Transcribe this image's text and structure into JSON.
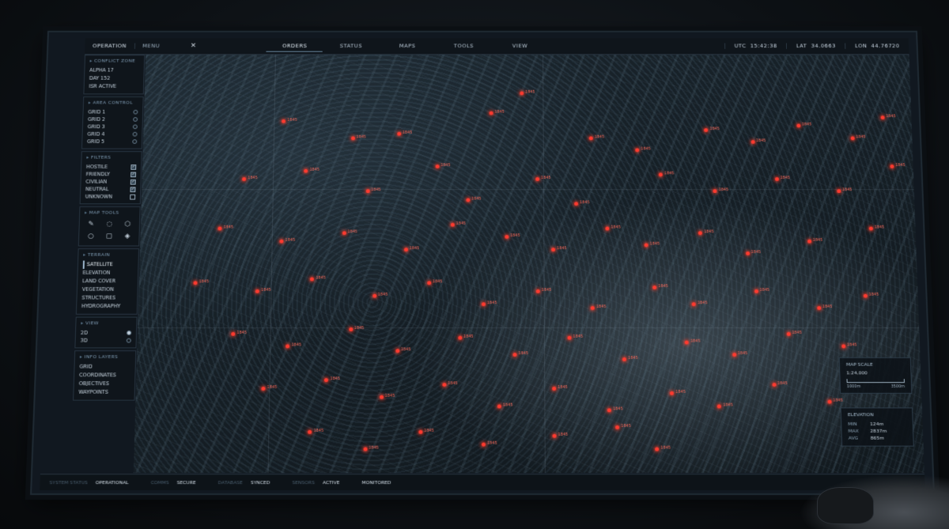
{
  "topbar": {
    "brand": "OPERATION",
    "menu": "MENU",
    "close_icon": "close-icon",
    "tabs": [
      "ORDERS",
      "STATUS",
      "MAPS",
      "TOOLS",
      "VIEW"
    ],
    "utc_label": "UTC",
    "utc_value": "15:42:38",
    "lat_label": "LAT",
    "lat_value": "34.0663",
    "lon_label": "LON",
    "lon_value": "44.76720"
  },
  "sidebar": {
    "conflict_zone": {
      "title": "CONFLICT ZONE",
      "lines": [
        "ALPHA 17",
        "DAY 152",
        "ISR ACTIVE"
      ]
    },
    "area_control": {
      "title": "AREA CONTROL",
      "items": [
        "GRID 1",
        "GRID 2",
        "GRID 3",
        "GRID 4",
        "GRID 5"
      ]
    },
    "filters": {
      "title": "FILTERS",
      "items": [
        {
          "label": "HOSTILE",
          "checked": true
        },
        {
          "label": "FRIENDLY",
          "checked": true
        },
        {
          "label": "CIVILIAN",
          "checked": true
        },
        {
          "label": "NEUTRAL",
          "checked": true
        },
        {
          "label": "UNKNOWN",
          "checked": false
        }
      ]
    },
    "map_tools": {
      "title": "MAP TOOLS",
      "tools": [
        "pencil-icon",
        "lasso-icon",
        "polygon-icon",
        "circle-icon",
        "rounded-shape-icon",
        "eraser-icon"
      ]
    },
    "terrain": {
      "title": "TERRAIN",
      "items": [
        "SATELLITE",
        "ELEVATION",
        "LAND COVER",
        "VEGETATION",
        "STRUCTURES",
        "HYDROGRAPHY"
      ],
      "active": "SATELLITE"
    },
    "view": {
      "title": "VIEW",
      "items": [
        "2D",
        "3D"
      ],
      "active": "2D"
    },
    "info_layers": {
      "title": "INFO LAYERS",
      "items": [
        "GRID",
        "COORDINATES",
        "OBJECTIVES",
        "WAYPOINTS"
      ]
    }
  },
  "map": {
    "marker_label": "1845",
    "markers": [
      [
        0.18,
        0.16
      ],
      [
        0.27,
        0.2
      ],
      [
        0.33,
        0.19
      ],
      [
        0.45,
        0.14
      ],
      [
        0.49,
        0.09
      ],
      [
        0.58,
        0.2
      ],
      [
        0.64,
        0.23
      ],
      [
        0.73,
        0.18
      ],
      [
        0.79,
        0.21
      ],
      [
        0.85,
        0.17
      ],
      [
        0.92,
        0.2
      ],
      [
        0.96,
        0.15
      ],
      [
        0.13,
        0.3
      ],
      [
        0.21,
        0.28
      ],
      [
        0.29,
        0.33
      ],
      [
        0.38,
        0.27
      ],
      [
        0.42,
        0.35
      ],
      [
        0.51,
        0.3
      ],
      [
        0.56,
        0.36
      ],
      [
        0.67,
        0.29
      ],
      [
        0.74,
        0.33
      ],
      [
        0.82,
        0.3
      ],
      [
        0.9,
        0.33
      ],
      [
        0.97,
        0.27
      ],
      [
        0.1,
        0.42
      ],
      [
        0.18,
        0.45
      ],
      [
        0.26,
        0.43
      ],
      [
        0.34,
        0.47
      ],
      [
        0.4,
        0.41
      ],
      [
        0.47,
        0.44
      ],
      [
        0.53,
        0.47
      ],
      [
        0.6,
        0.42
      ],
      [
        0.65,
        0.46
      ],
      [
        0.72,
        0.43
      ],
      [
        0.78,
        0.48
      ],
      [
        0.86,
        0.45
      ],
      [
        0.94,
        0.42
      ],
      [
        0.07,
        0.55
      ],
      [
        0.15,
        0.57
      ],
      [
        0.22,
        0.54
      ],
      [
        0.3,
        0.58
      ],
      [
        0.37,
        0.55
      ],
      [
        0.44,
        0.6
      ],
      [
        0.51,
        0.57
      ],
      [
        0.58,
        0.61
      ],
      [
        0.66,
        0.56
      ],
      [
        0.71,
        0.6
      ],
      [
        0.79,
        0.57
      ],
      [
        0.87,
        0.61
      ],
      [
        0.93,
        0.58
      ],
      [
        0.12,
        0.67
      ],
      [
        0.19,
        0.7
      ],
      [
        0.27,
        0.66
      ],
      [
        0.33,
        0.71
      ],
      [
        0.41,
        0.68
      ],
      [
        0.48,
        0.72
      ],
      [
        0.55,
        0.68
      ],
      [
        0.62,
        0.73
      ],
      [
        0.7,
        0.69
      ],
      [
        0.76,
        0.72
      ],
      [
        0.83,
        0.67
      ],
      [
        0.9,
        0.7
      ],
      [
        0.16,
        0.8
      ],
      [
        0.24,
        0.78
      ],
      [
        0.31,
        0.82
      ],
      [
        0.39,
        0.79
      ],
      [
        0.46,
        0.84
      ],
      [
        0.53,
        0.8
      ],
      [
        0.6,
        0.85
      ],
      [
        0.68,
        0.81
      ],
      [
        0.74,
        0.84
      ],
      [
        0.81,
        0.79
      ],
      [
        0.88,
        0.83
      ],
      [
        0.36,
        0.9
      ],
      [
        0.44,
        0.93
      ],
      [
        0.53,
        0.91
      ],
      [
        0.61,
        0.89
      ],
      [
        0.66,
        0.94
      ],
      [
        0.22,
        0.9
      ],
      [
        0.29,
        0.94
      ]
    ]
  },
  "map_scale": {
    "title": "MAP SCALE",
    "ratio": "1:24,000",
    "left": "1000m",
    "right": "3500m"
  },
  "elevation": {
    "title": "ELEVATION",
    "min_label": "MIN",
    "min_value": "124m",
    "max_label": "MAX",
    "max_value": "2837m",
    "avg_label": "AVG",
    "avg_value": "865m"
  },
  "statusbar": [
    {
      "label": "SYSTEM STATUS",
      "value": "OPERATIONAL"
    },
    {
      "label": "COMMS",
      "value": "SECURE"
    },
    {
      "label": "DATABASE",
      "value": "SYNCED"
    },
    {
      "label": "SENSORS",
      "value": "ACTIVE"
    },
    {
      "label": "",
      "value": "MONITORED"
    }
  ],
  "colors": {
    "marker": "#ff3b30",
    "panel_bg": "#0f151b",
    "accent": "#9fb9cf"
  }
}
